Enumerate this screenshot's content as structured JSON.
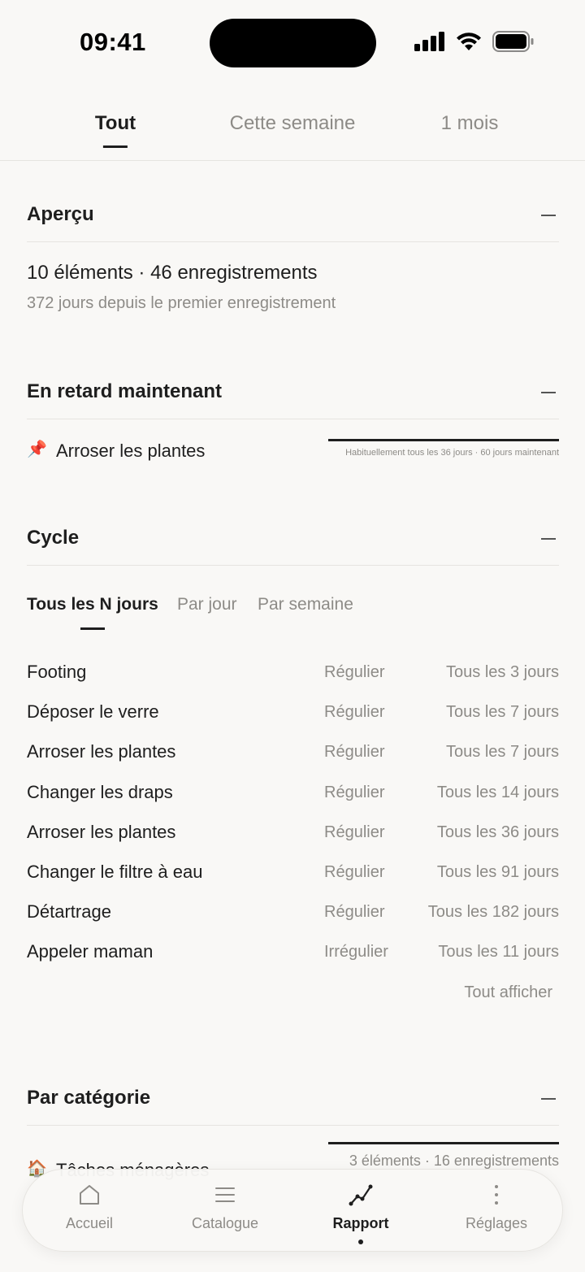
{
  "status_bar": {
    "time": "09:41"
  },
  "top_tabs": [
    {
      "label": "Tout",
      "active": true
    },
    {
      "label": "Cette semaine",
      "active": false
    },
    {
      "label": "1 mois",
      "active": false
    }
  ],
  "overview": {
    "title": "Aperçu",
    "summary": "10 éléments · 46 enregistrements",
    "since": "372 jours depuis le premier enregistrement"
  },
  "overdue": {
    "title": "En retard maintenant",
    "item_label": "Arroser les plantes",
    "item_icon": "pushpin-icon",
    "caption": "Habituellement tous les 36 jours · 60 jours maintenant"
  },
  "cycle": {
    "title": "Cycle",
    "tabs": [
      {
        "label": "Tous les N jours",
        "active": true
      },
      {
        "label": "Par jour",
        "active": false
      },
      {
        "label": "Par semaine",
        "active": false
      }
    ],
    "rows": [
      {
        "name": "Footing",
        "kind": "Régulier",
        "freq": "Tous les 3 jours"
      },
      {
        "name": "Déposer le verre",
        "kind": "Régulier",
        "freq": "Tous les 7 jours"
      },
      {
        "name": "Arroser les plantes",
        "kind": "Régulier",
        "freq": "Tous les 7 jours"
      },
      {
        "name": "Changer les draps",
        "kind": "Régulier",
        "freq": "Tous les 14 jours"
      },
      {
        "name": "Arroser les plantes",
        "kind": "Régulier",
        "freq": "Tous les 36 jours"
      },
      {
        "name": "Changer le filtre à eau",
        "kind": "Régulier",
        "freq": "Tous les 91 jours"
      },
      {
        "name": "Détartrage",
        "kind": "Régulier",
        "freq": "Tous les 182 jours"
      },
      {
        "name": "Appeler maman",
        "kind": "Irrégulier",
        "freq": "Tous les 11 jours"
      }
    ],
    "show_all": "Tout afficher"
  },
  "by_category": {
    "title": "Par catégorie",
    "first": {
      "label": "Tâches ménagères",
      "icon": "house-icon",
      "caption": "3 éléments · 16 enregistrements"
    }
  },
  "bottom_nav": [
    {
      "label": "Accueil",
      "icon": "home-icon",
      "active": false
    },
    {
      "label": "Catalogue",
      "icon": "list-icon",
      "active": false
    },
    {
      "label": "Rapport",
      "icon": "chart-line-icon",
      "active": true
    },
    {
      "label": "Réglages",
      "icon": "more-vertical-icon",
      "active": false
    }
  ]
}
